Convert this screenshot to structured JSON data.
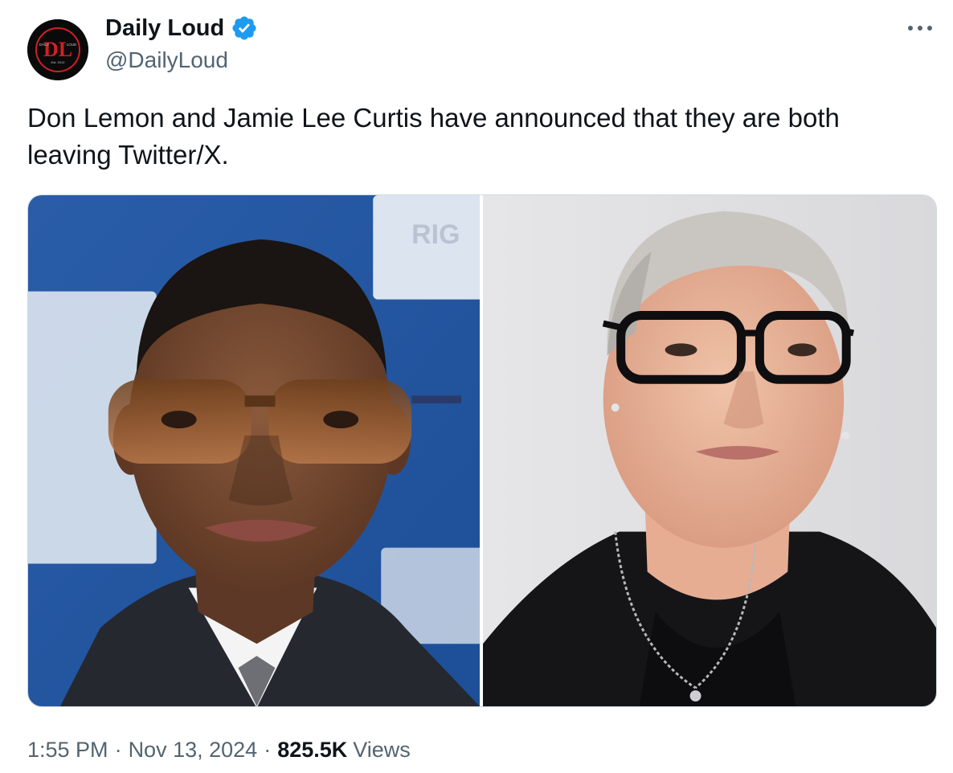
{
  "author": {
    "display_name": "Daily Loud",
    "handle": "@DailyLoud",
    "avatar_icon": "daily-loud-logo",
    "avatar_text": {
      "monogram": "DL",
      "left": "DAILY",
      "right": "LOUD",
      "established": "Est. 2012"
    },
    "verified": true,
    "verified_color": "#1d9bf0"
  },
  "more_icon": "ellipsis-icon",
  "tweet": {
    "text": "Don Lemon and Jamie Lee Curtis have announced that they are both leaving Twitter/X."
  },
  "media": {
    "left_photo_text": "RIG",
    "items": [
      "left-photo",
      "right-photo"
    ]
  },
  "meta": {
    "time": "1:55 PM",
    "separator": "·",
    "date": "Nov 13, 2024",
    "views_count": "825.5K",
    "views_label": "Views"
  },
  "colors": {
    "text_primary": "#0f1419",
    "text_secondary": "#536471",
    "border": "#cfd9de",
    "brand_red": "#d11f26"
  }
}
